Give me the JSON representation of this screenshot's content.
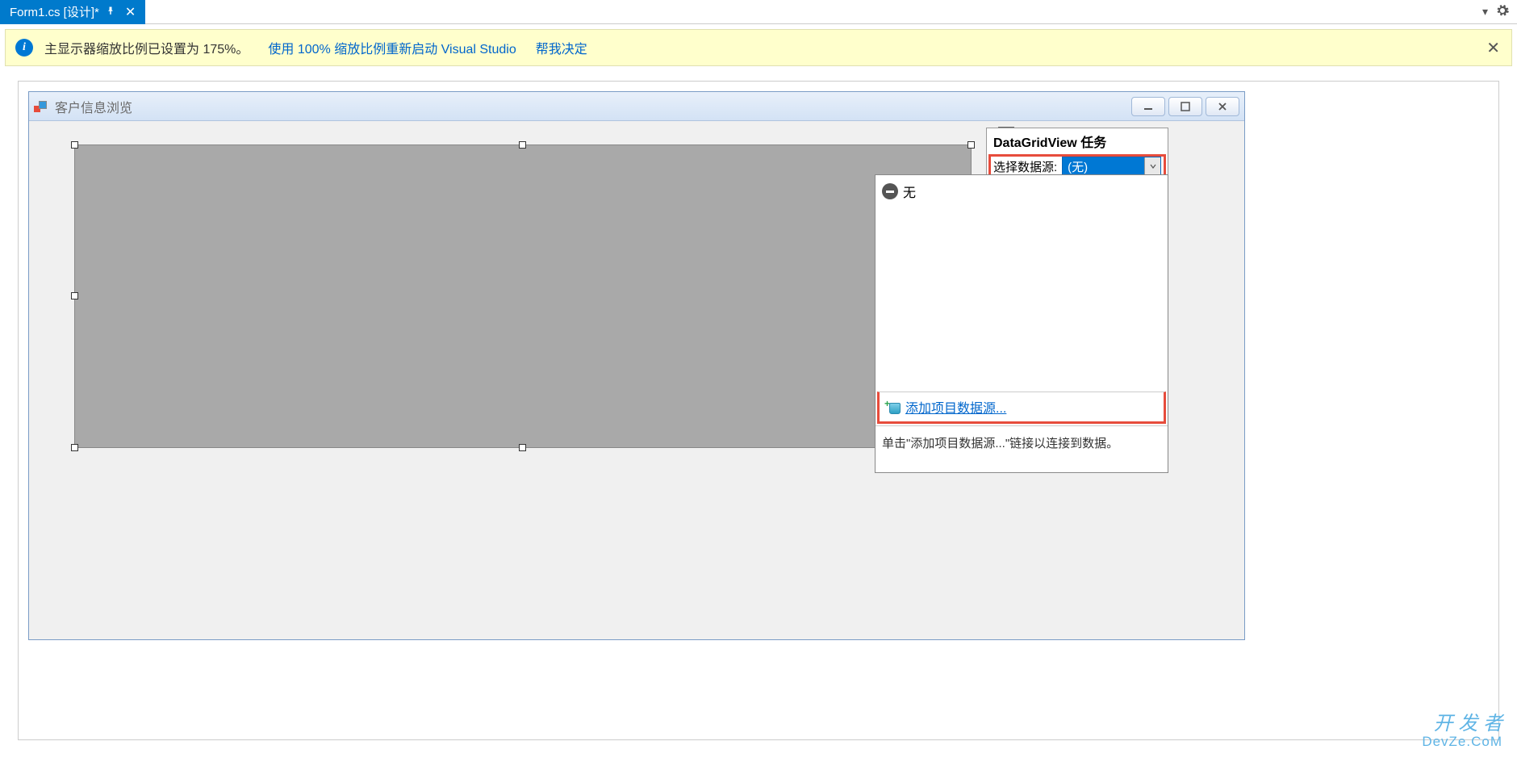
{
  "tab": {
    "title": "Form1.cs [设计]*"
  },
  "infobar": {
    "message": "主显示器缩放比例已设置为 175%。",
    "link1": "使用 100% 缩放比例重新启动 Visual Studio",
    "link2": "帮我决定"
  },
  "form": {
    "title": "客户信息浏览"
  },
  "tasks": {
    "header": "DataGridView 任务",
    "datasource_label": "选择数据源:",
    "datasource_value": "(无)"
  },
  "dropdown": {
    "none_label": "无",
    "add_link": "添加项目数据源...",
    "hint": "单击\"添加项目数据源...\"链接以连接到数据。"
  },
  "watermark": {
    "line1": "开 发 者",
    "line2": "DevZe.CoM"
  }
}
